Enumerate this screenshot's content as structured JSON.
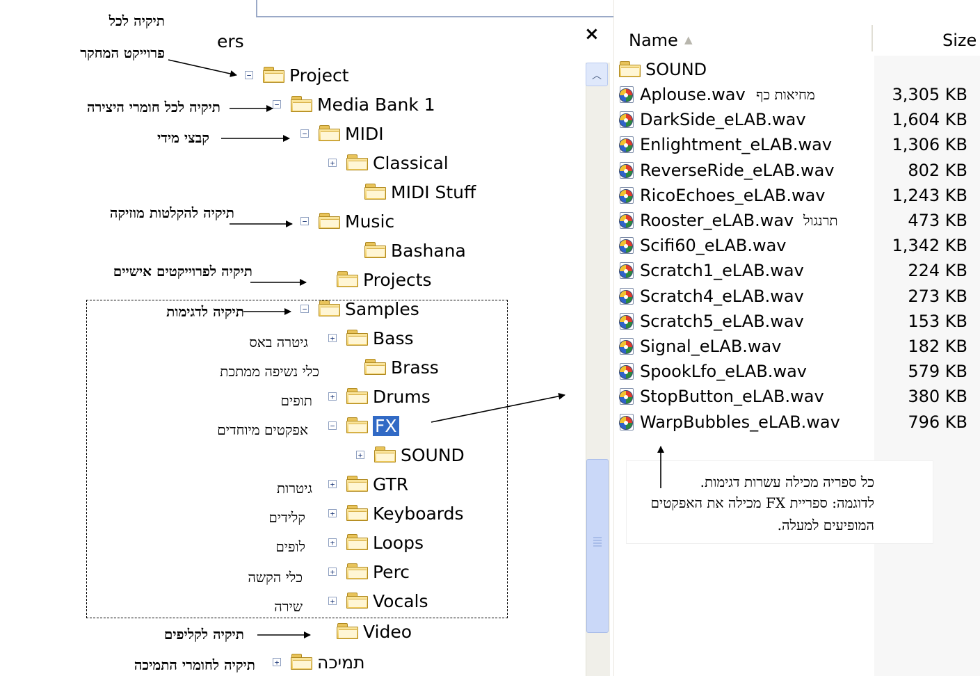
{
  "folders_pane": {
    "title_fragment": "ers",
    "close_glyph": "×"
  },
  "tree": [
    {
      "label": "Project",
      "expander": "−"
    },
    {
      "label": "Media Bank 1",
      "expander": "−"
    },
    {
      "label": "MIDI",
      "expander": "−"
    },
    {
      "label": "Classical",
      "expander": "+"
    },
    {
      "label": "MIDI Stuff",
      "expander": ""
    },
    {
      "label": "Music",
      "expander": "−"
    },
    {
      "label": "Bashana",
      "expander": ""
    },
    {
      "label": "Projects",
      "expander": ""
    },
    {
      "label": "Samples",
      "expander": "−"
    },
    {
      "label": "Bass",
      "expander": "+"
    },
    {
      "label": "Brass",
      "expander": ""
    },
    {
      "label": "Drums",
      "expander": "+"
    },
    {
      "label": "FX",
      "expander": "−",
      "selected": true
    },
    {
      "label": "SOUND",
      "expander": "+"
    },
    {
      "label": "GTR",
      "expander": "+"
    },
    {
      "label": "Keyboards",
      "expander": "+"
    },
    {
      "label": "Loops",
      "expander": "+"
    },
    {
      "label": "Perc",
      "expander": "+"
    },
    {
      "label": "Vocals",
      "expander": "+"
    },
    {
      "label": "Video",
      "expander": ""
    },
    {
      "label": "תמיכה",
      "expander": "+"
    }
  ],
  "file_list": {
    "columns": {
      "name": "Name",
      "size": "Size"
    },
    "sort_icon": "triangle-up-icon",
    "folder_entry": "SOUND",
    "files": [
      {
        "name": "Aplouse.wav",
        "size": "3,305 KB",
        "note": "מחיאות כף"
      },
      {
        "name": "DarkSide_eLAB.wav",
        "size": "1,604 KB"
      },
      {
        "name": "Enlightment_eLAB.wav",
        "size": "1,306 KB"
      },
      {
        "name": "ReverseRide_eLAB.wav",
        "size": "802 KB"
      },
      {
        "name": "RicoEchoes_eLAB.wav",
        "size": "1,243 KB"
      },
      {
        "name": "Rooster_eLAB.wav",
        "size": "473 KB",
        "note": "תרנגול"
      },
      {
        "name": "Scifi60_eLAB.wav",
        "size": "1,342 KB"
      },
      {
        "name": "Scratch1_eLAB.wav",
        "size": "224 KB"
      },
      {
        "name": "Scratch4_eLAB.wav",
        "size": "273 KB"
      },
      {
        "name": "Scratch5_eLAB.wav",
        "size": "153 KB"
      },
      {
        "name": "Signal_eLAB.wav",
        "size": "182 KB"
      },
      {
        "name": "SpookLfo_eLAB.wav",
        "size": "579 KB"
      },
      {
        "name": "StopButton_eLAB.wav",
        "size": "380 KB"
      },
      {
        "name": "WarpBubbles_eLAB.wav",
        "size": "796 KB"
      }
    ]
  },
  "callouts": {
    "project_line1": "תיקיה לכל",
    "project_line2": "פרוייקט המחקר",
    "media_bank": "תיקיה לכל חומרי היצירה",
    "midi": "קבצי מידי",
    "music": "תיקיה להקלטות מוזיקה",
    "projects": "תיקיה לפרוייקטים אישיים",
    "samples": "תיקיה לדגימות",
    "video": "תיקיה לקליפים",
    "support": "תיקיה לחומרי התמיכה"
  },
  "sample_notes": {
    "bass": "גיטרה באס",
    "brass": "כלי נשיפה ממתכת",
    "drums": "תופים",
    "fx": "אפקטים מיוחדים",
    "gtr": "גיטרות",
    "keyboards": "קלידים",
    "loops": "לופים",
    "perc": "כלי הקשה",
    "vocals": "שירה"
  },
  "annotation": {
    "line1": "כל ספריה מכילה עשרות דגימות.",
    "line2": "לדוגמה: ספריית FX מכילה את האפקטים",
    "line3": "המופיעים למעלה."
  }
}
